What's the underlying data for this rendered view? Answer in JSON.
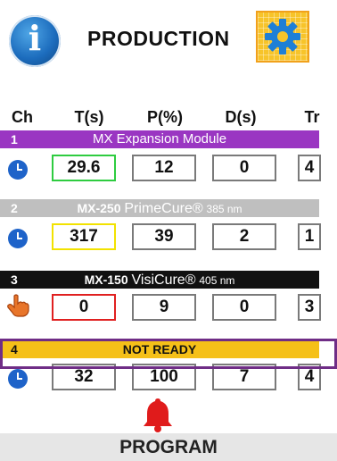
{
  "header": {
    "title": "PRODUCTION",
    "info_label": "i",
    "colors": {
      "info_blue": "#1c6cbd",
      "gear_gold": "#f7c42a"
    }
  },
  "columns": [
    "Ch",
    "T(s)",
    "P(%)",
    "D(s)",
    "Tr"
  ],
  "channels": [
    {
      "num": "1",
      "label": "MX Expansion Module",
      "bar_color": "#9a36c2",
      "icon": "clock-icon",
      "t": "29.6",
      "p": "12",
      "d": "0",
      "tr": "4",
      "t_border": "#2ecc40"
    },
    {
      "num": "2",
      "label_model": "MX-250",
      "label_name": "PrimeCure®",
      "label_wave": "385 nm",
      "bar_color": "#bfbfbf",
      "icon": "clock-icon",
      "t": "317",
      "p": "39",
      "d": "2",
      "tr": "1",
      "t_border": "#f2e200"
    },
    {
      "num": "3",
      "label_model": "MX-150",
      "label_name": "VisiCure®",
      "label_wave": "405 nm",
      "bar_color": "#111111",
      "icon": "hand-icon",
      "t": "0",
      "p": "9",
      "d": "0",
      "tr": "3",
      "t_border": "#e02020"
    },
    {
      "num": "4",
      "label": "NOT READY",
      "bar_color": "#f5c018",
      "icon": "clock-icon",
      "t": "32",
      "p": "100",
      "d": "7",
      "tr": "4",
      "t_border": "#7a7a7a"
    }
  ],
  "alarm_icon": "bell-icon",
  "program_label": "PROGRAM"
}
